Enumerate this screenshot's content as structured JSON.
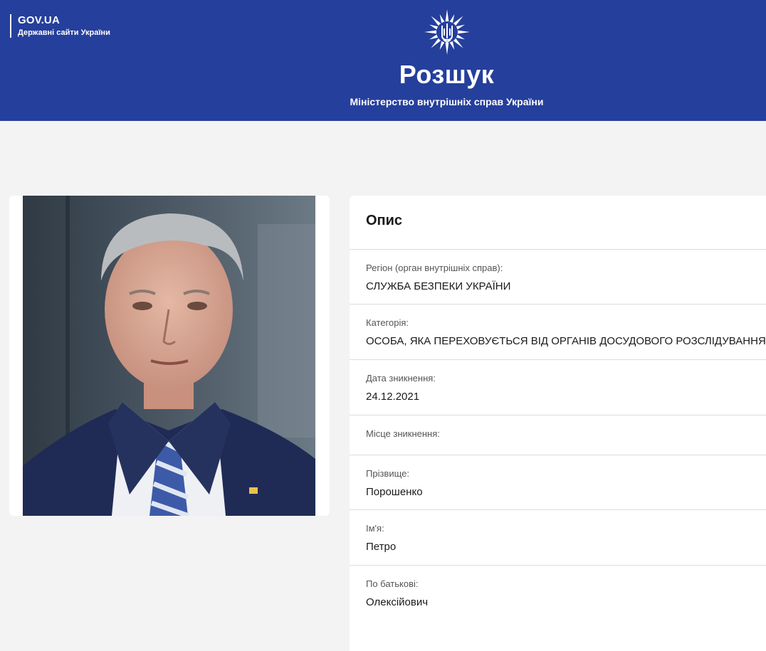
{
  "gov_badge": {
    "title": "GOV.UA",
    "subtitle": "Державні сайти України"
  },
  "header": {
    "emblem_icon": "police-star-trident-icon",
    "title": "Розшук",
    "subtitle": "Міністерство внутрішніх справ України"
  },
  "colors": {
    "header_bg": "#253f9c",
    "page_bg": "#f3f3f3",
    "card_bg": "#ffffff"
  },
  "person_photo": {
    "icon": "person-photo"
  },
  "details": {
    "heading": "Опис",
    "fields": [
      {
        "label": "Регіон (орган внутрішніх справ):",
        "value": "СЛУЖБА БЕЗПЕКИ УКРАЇНИ"
      },
      {
        "label": "Категорія:",
        "value": "ОСОБА, ЯКА ПЕРЕХОВУЄТЬСЯ ВІД ОРГАНІВ ДОСУДОВОГО РОЗСЛІДУВАННЯ"
      },
      {
        "label": "Дата зникнення:",
        "value": "24.12.2021"
      },
      {
        "label": "Місце зникнення:",
        "value": ""
      },
      {
        "label": "Прізвище:",
        "value": "Порошенко"
      },
      {
        "label": "Ім'я:",
        "value": "Петро"
      },
      {
        "label": "По батькові:",
        "value": "Олексійович"
      }
    ]
  }
}
